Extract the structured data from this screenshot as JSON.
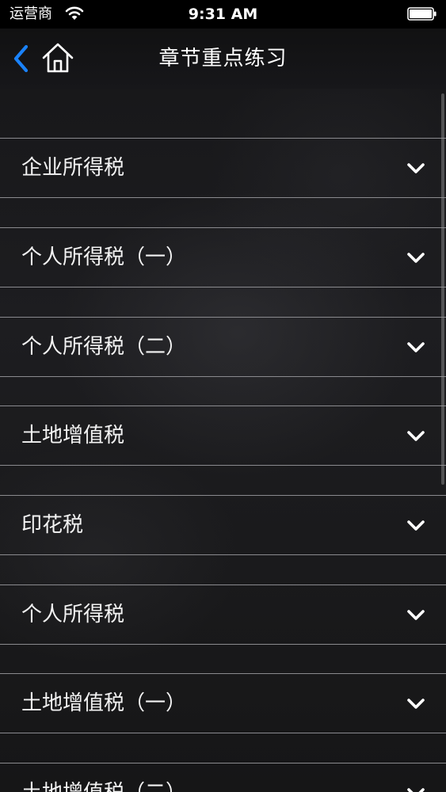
{
  "status_bar": {
    "carrier": "运营商",
    "time": "9:31 AM"
  },
  "nav": {
    "title": "章节重点练习",
    "back_icon": "chevron-left-icon",
    "home_icon": "home-icon",
    "accent_color": "#1a82fb"
  },
  "list": {
    "items": [
      {
        "label": "企业所得税"
      },
      {
        "label": "个人所得税（一）"
      },
      {
        "label": "个人所得税（二）"
      },
      {
        "label": "土地增值税"
      },
      {
        "label": "印花税"
      },
      {
        "label": "个人所得税"
      },
      {
        "label": "土地增值税（一）"
      },
      {
        "label": "土地增值税（二）"
      }
    ],
    "expand_icon": "chevron-down-icon"
  }
}
